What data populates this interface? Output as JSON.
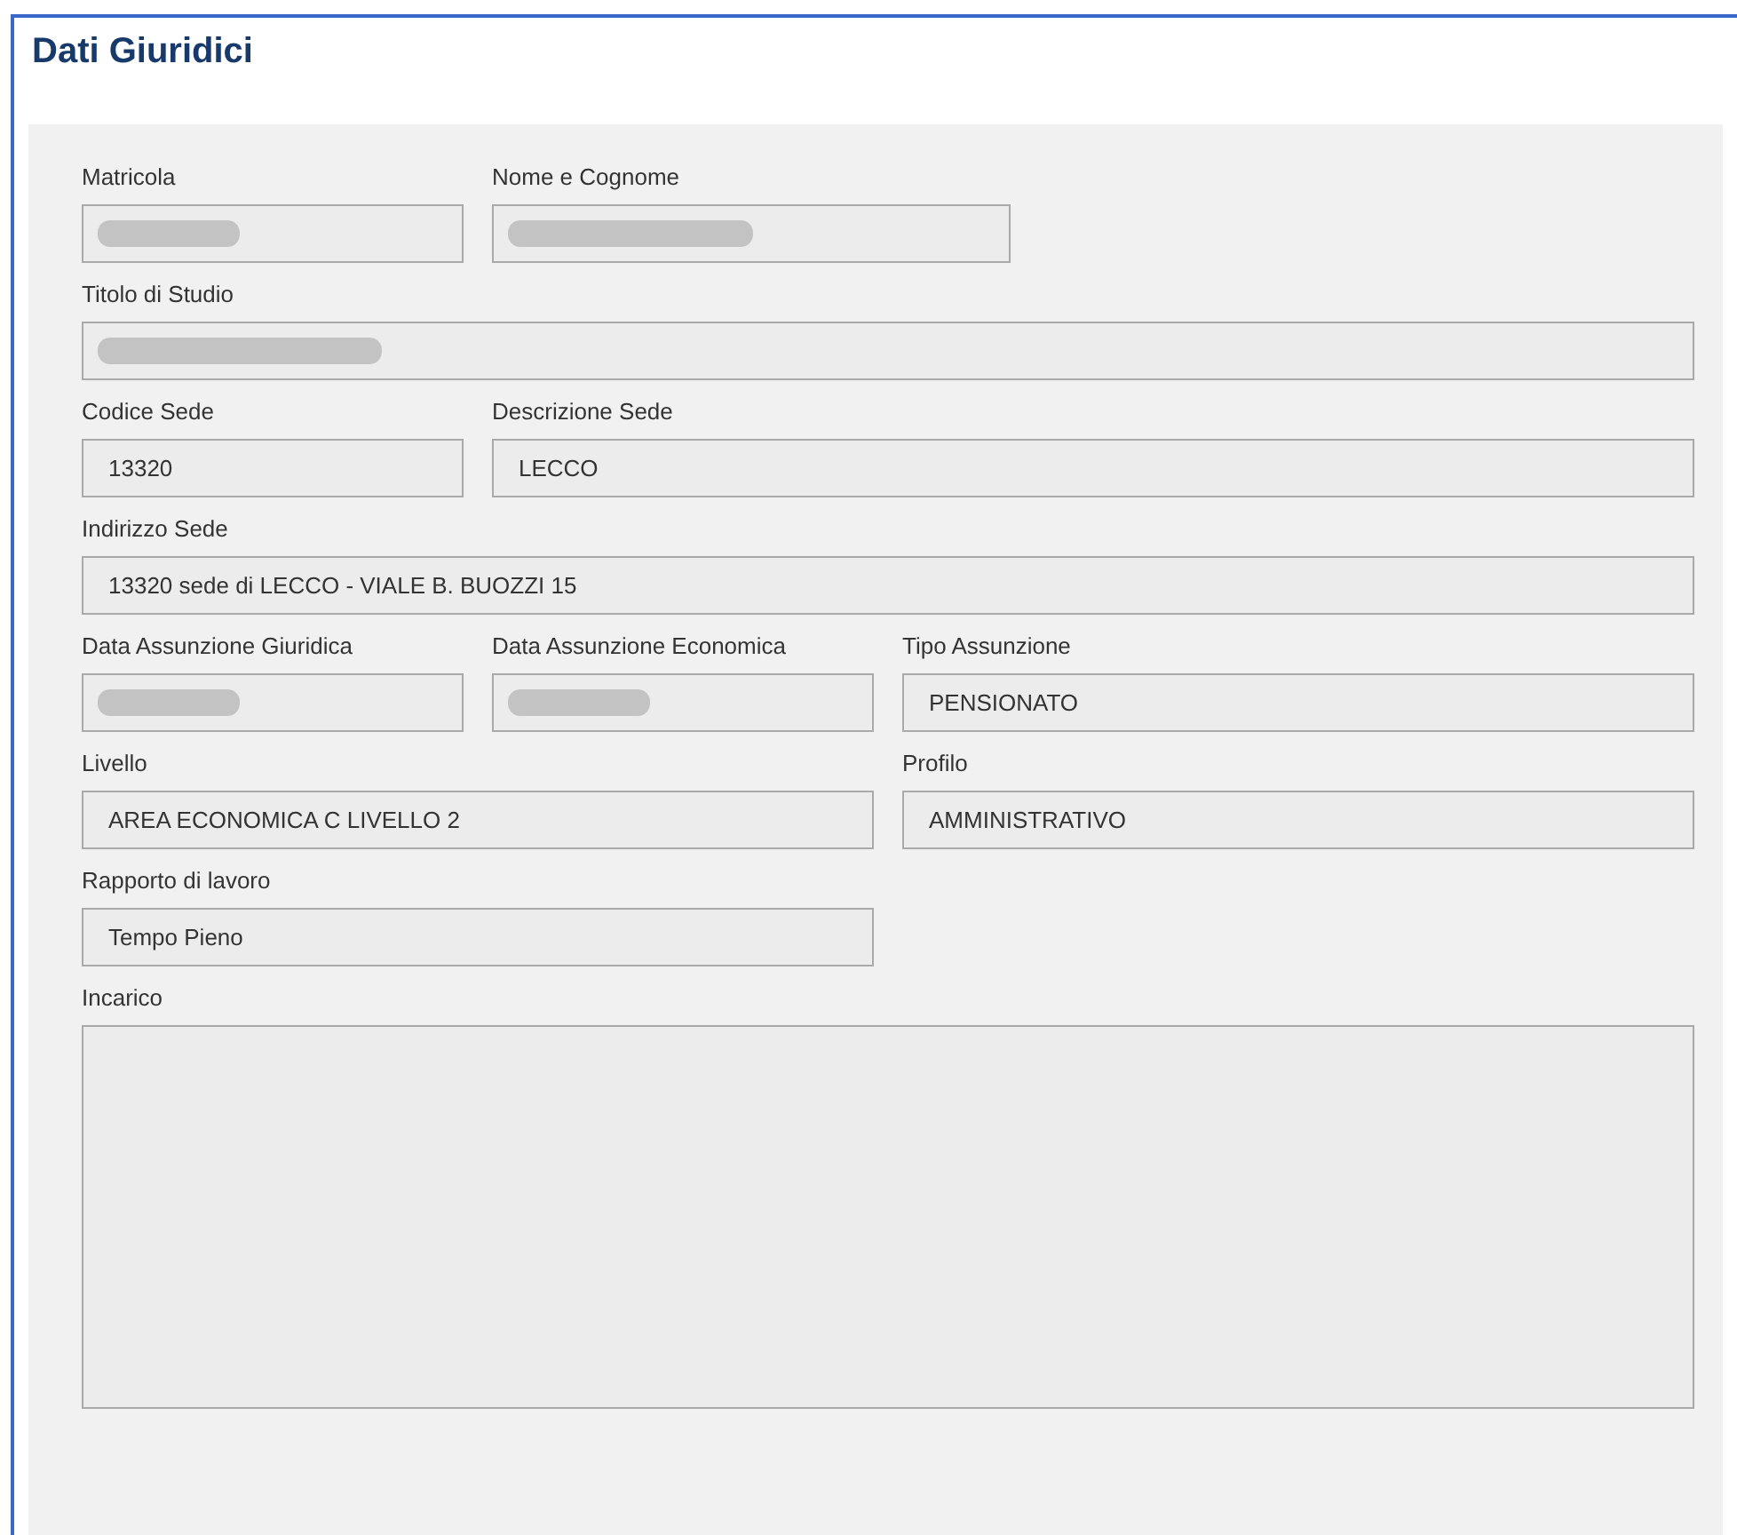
{
  "title": "Dati Giuridici",
  "rows": [
    [
      {
        "label": "Matricola",
        "redacted": true
      },
      {
        "label": "Nome e Cognome",
        "redacted": true
      }
    ],
    [
      {
        "label": "Titolo di Studio",
        "redacted": true
      }
    ],
    [
      {
        "label": "Codice Sede",
        "value": "13320"
      },
      {
        "label": "Descrizione Sede",
        "value": "LECCO"
      }
    ],
    [
      {
        "label": "Indirizzo Sede",
        "value": "13320 sede di LECCO - VIALE B. BUOZZI 15"
      }
    ],
    [
      {
        "label": "Data Assunzione Giuridica",
        "redacted": true
      },
      {
        "label": "Data Assunzione Economica",
        "redacted": true
      },
      {
        "label": "Tipo Assunzione",
        "value": "PENSIONATO"
      }
    ],
    [
      {
        "label": "Livello",
        "value": "AREA ECONOMICA C LIVELLO 2"
      },
      {
        "label": "Profilo",
        "value": "AMMINISTRATIVO"
      }
    ],
    [
      {
        "label": "Rapporto di lavoro",
        "value": "Tempo Pieno"
      }
    ],
    [
      {
        "label": "Incarico",
        "kind": "textarea"
      }
    ]
  ]
}
